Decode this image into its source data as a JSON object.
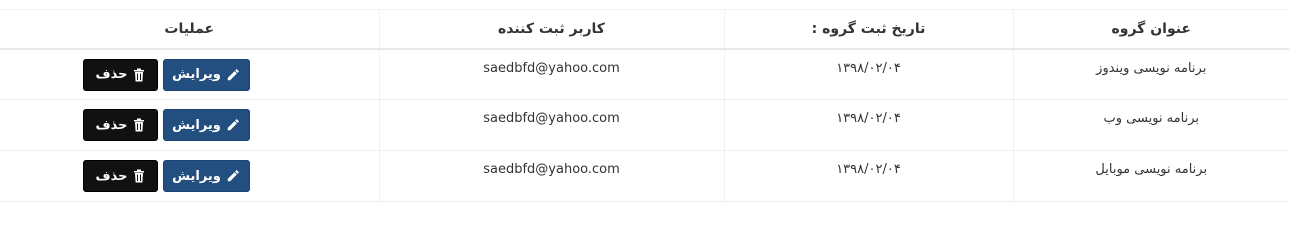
{
  "table": {
    "headers": {
      "title": "عنوان گروه",
      "date": "تاریخ ثبت گروه :",
      "user": "کاربر ثبت کننده",
      "ops": "عملیات"
    },
    "rows": [
      {
        "title": "برنامه نویسی ویندوز",
        "date": "۱۳۹۸/۰۲/۰۴",
        "user": "saedbfd@yahoo.com",
        "edit_label": "ویرایش",
        "delete_label": "حذف"
      },
      {
        "title": "برنامه نویسی وب",
        "date": "۱۳۹۸/۰۲/۰۴",
        "user": "saedbfd@yahoo.com",
        "edit_label": "ویرایش",
        "delete_label": "حذف"
      },
      {
        "title": "برنامه نویسی موبایل",
        "date": "۱۳۹۸/۰۲/۰۴",
        "user": "saedbfd@yahoo.com",
        "edit_label": "ویرایش",
        "delete_label": "حذف"
      }
    ]
  },
  "icons": {
    "edit": "pencil-icon",
    "delete": "trash-icon"
  },
  "colors": {
    "edit_button": "#234e80",
    "delete_button": "#111111"
  }
}
